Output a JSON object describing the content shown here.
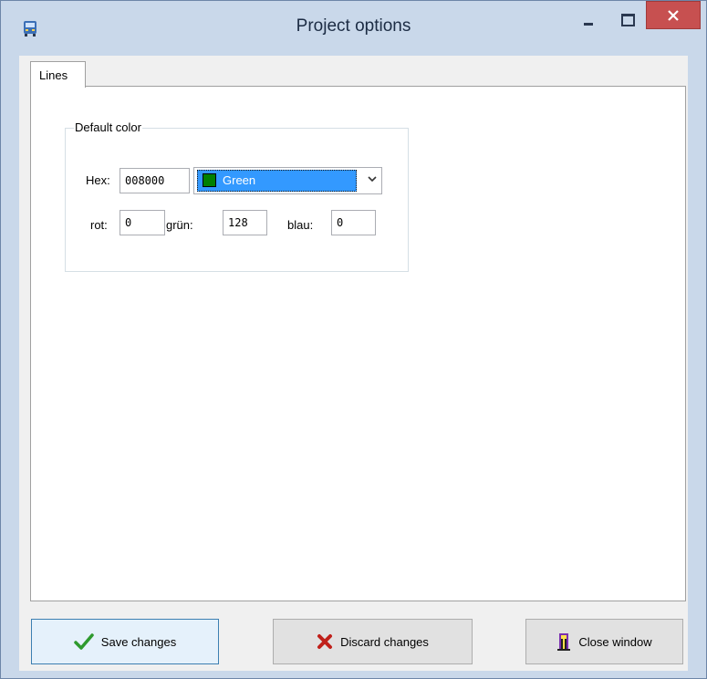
{
  "window": {
    "title": "Project options",
    "icon": "bus-icon"
  },
  "tabs": [
    {
      "label": "Lines",
      "selected": true
    }
  ],
  "default_color": {
    "group_label": "Default color",
    "hex_label": "Hex:",
    "hex_value": "008000",
    "color_name": "Green",
    "swatch_color": "#008000",
    "red_label": "rot:",
    "red_value": "0",
    "green_label": "grün:",
    "green_value": "128",
    "blue_label": "blau:",
    "blue_value": "0"
  },
  "buttons": {
    "save": {
      "label": "Save changes",
      "icon": "checkmark-icon",
      "color": "#2e9a2e"
    },
    "discard": {
      "label": "Discard changes",
      "icon": "x-cross-icon",
      "color": "#c0201a"
    },
    "close": {
      "label": "Close window",
      "icon": "exit-door-icon"
    }
  },
  "colors": {
    "window_frame": "#c9d8ea",
    "close_button": "#c75050",
    "selection": "#3399ff"
  }
}
